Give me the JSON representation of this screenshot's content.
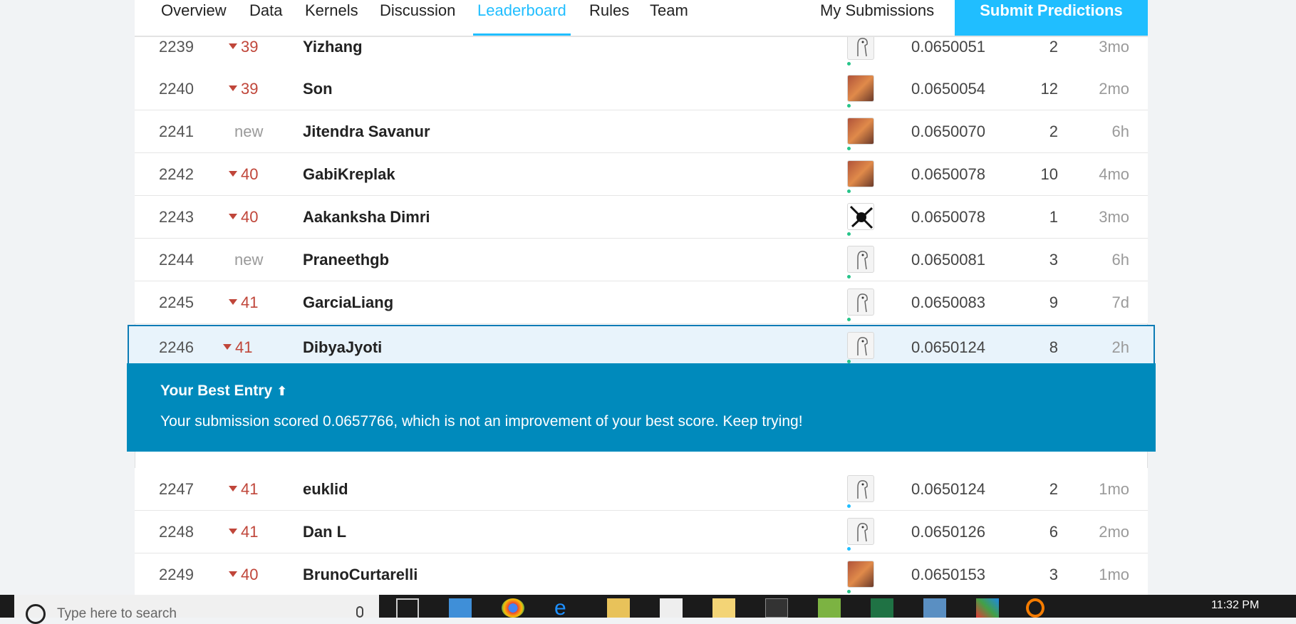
{
  "nav": {
    "tabs": [
      "Overview",
      "Data",
      "Kernels",
      "Discussion",
      "Leaderboard",
      "Rules",
      "Team"
    ],
    "active_tab": "Leaderboard",
    "my_submissions": "My Submissions",
    "submit": "Submit Predictions"
  },
  "rows_before": [
    {
      "rank": "2239",
      "change": "39",
      "name": "Yizhang",
      "score": "0.0650051",
      "entries": "2",
      "last": "3mo",
      "avatar": "kaggle-default-icon"
    },
    {
      "rank": "2240",
      "change": "39",
      "name": "Son",
      "score": "0.0650054",
      "entries": "12",
      "last": "2mo",
      "avatar": "photo-avatar"
    },
    {
      "rank": "2241",
      "change": "new",
      "name": "Jitendra Savanur",
      "score": "0.0650070",
      "entries": "2",
      "last": "6h",
      "avatar": "photo-avatar"
    },
    {
      "rank": "2242",
      "change": "40",
      "name": "GabiKreplak",
      "score": "0.0650078",
      "entries": "10",
      "last": "4mo",
      "avatar": "photo-avatar"
    },
    {
      "rank": "2243",
      "change": "40",
      "name": "Aakanksha Dimri",
      "score": "0.0650078",
      "entries": "1",
      "last": "3mo",
      "avatar": "sketch-avatar"
    },
    {
      "rank": "2244",
      "change": "new",
      "name": "Praneethgb",
      "score": "0.0650081",
      "entries": "3",
      "last": "6h",
      "avatar": "kaggle-default-icon"
    },
    {
      "rank": "2245",
      "change": "41",
      "name": "GarciaLiang",
      "score": "0.0650083",
      "entries": "9",
      "last": "7d",
      "avatar": "kaggle-default-icon"
    }
  ],
  "my_row": {
    "rank": "2246",
    "change": "41",
    "name": "DibyaJyoti",
    "score": "0.0650124",
    "entries": "8",
    "last": "2h",
    "avatar": "kaggle-default-icon"
  },
  "banner": {
    "title": "Your Best Entry",
    "message": "Your submission scored 0.0657766, which is not an improvement of your best score. Keep trying!"
  },
  "rows_after": [
    {
      "rank": "2247",
      "change": "41",
      "name": "euklid",
      "score": "0.0650124",
      "entries": "2",
      "last": "1mo",
      "avatar": "kaggle-default-icon"
    },
    {
      "rank": "2248",
      "change": "41",
      "name": "Dan L",
      "score": "0.0650126",
      "entries": "6",
      "last": "2mo",
      "avatar": "kaggle-default-icon"
    },
    {
      "rank": "2249",
      "change": "40",
      "name": "BrunoCurtarelli",
      "score": "0.0650153",
      "entries": "3",
      "last": "1mo",
      "avatar": "photo-avatar"
    }
  ],
  "taskbar": {
    "search_placeholder": "Type here to search",
    "time": "11:32 PM"
  },
  "colors": {
    "accent": "#20beff",
    "banner": "#008abc",
    "down": "#c0463a"
  }
}
